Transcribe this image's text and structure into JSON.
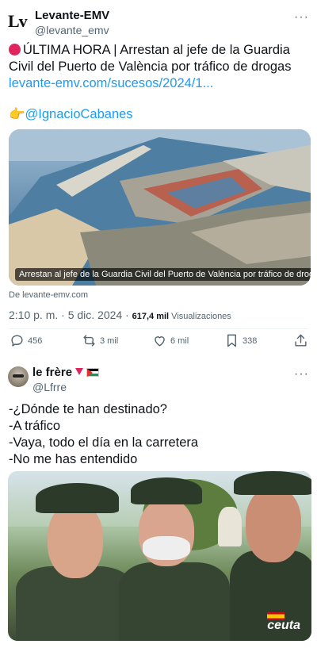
{
  "tweet1": {
    "author": {
      "name": "Levante-EMV",
      "handle": "@levante_emv",
      "avatar_text": "Lv"
    },
    "more_icon": "more-horizontal-icon",
    "headline": "ÚLTIMA HORA | Arrestan al jefe de la Guardia Civil del Puerto de València por tráfico de drogas",
    "link": "levante-emv.com/sucesos/2024/1...",
    "mention_emoji": "👉",
    "mention": "@IgnacioCabanes",
    "card": {
      "caption": "Arrestan al jefe de la Guardia Civil del Puerto de València por tráfico de drogas",
      "source": "De levante-emv.com"
    },
    "meta": {
      "time": "2:10 p. m. · 5 dic. 2024 · ",
      "views_count": "617,4 mil",
      "views_label": " Visualizaciones"
    },
    "actions": {
      "replies": "456",
      "reposts": "3 mil",
      "likes": "6 mil",
      "bookmarks": "338"
    },
    "colors": {
      "link": "#1d9bf0",
      "text": "#0f1419",
      "secondary": "#536471",
      "alert": "#e0245e"
    }
  },
  "tweet2": {
    "author": {
      "name": "le frère",
      "handle": "@Lfrre"
    },
    "lines": [
      "-¿Dónde te han destinado?",
      "-A tráfico",
      "-Vaya, todo el día en la carretera",
      "-No me has entendido"
    ],
    "image_watermark": "ceuta"
  }
}
